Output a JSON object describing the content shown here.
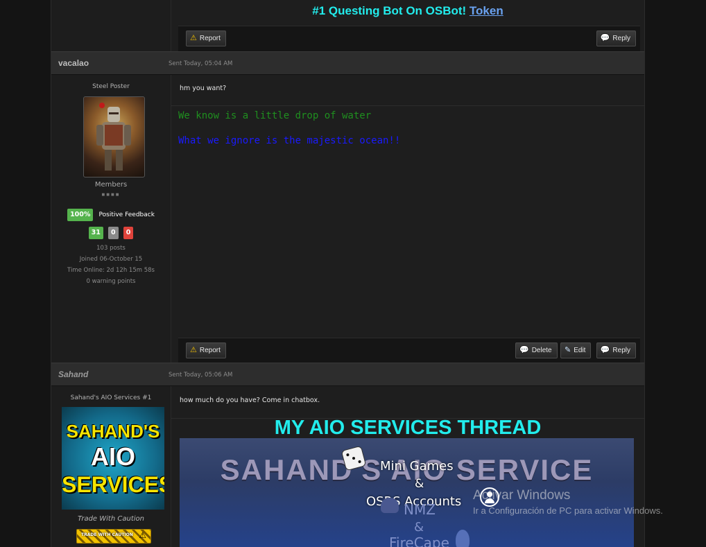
{
  "top_post": {
    "signature": {
      "prefix": "#1 Questing Bot On OSBot! ",
      "link": "Token"
    },
    "buttons": {
      "report": "Report",
      "reply": "Reply"
    }
  },
  "post1": {
    "username": "vacalao",
    "sent": "Sent Today, 05:04 AM",
    "user_title": "Steel Poster",
    "group": "Members",
    "pips": "■■■■",
    "feedback": {
      "percent": "100%",
      "label": "Positive Feedback",
      "positive": "31",
      "neutral": "0",
      "negative": "0"
    },
    "stats": {
      "posts": "103 posts",
      "joined": "Joined 06-October 15",
      "online": "Time Online: 2d 12h 15m 58s",
      "warnings": "0 warning points"
    },
    "message": "hm you want?",
    "signature": {
      "line1": "We know is a little drop of water",
      "line2": "What we ignore is the majestic ocean!!"
    },
    "buttons": {
      "report": "Report",
      "delete": "Delete",
      "edit": "Edit",
      "reply": "Reply"
    }
  },
  "post2": {
    "username": "Sahand",
    "sent": "Sent Today, 05:06 AM",
    "user_title": "Sahand's AIO Services #1",
    "avatar_text": {
      "line1": "SAHAND'S",
      "line2": "AIO",
      "line3": "SERVICES"
    },
    "caution": "Trade With Caution",
    "badge_text": "TRADE WITH CAUTION",
    "message": "how much do you have? Come in chatbox.",
    "signature": {
      "title": "MY AIO SERVICES THREAD",
      "banner_title": "SAHAND'S AIO SERVICE",
      "lines": [
        "Mini Games",
        "&",
        "OSRS Accounts",
        "NMZ",
        "&",
        "FireCape"
      ]
    }
  },
  "windows_watermark": {
    "title": "Activar Windows",
    "subtitle": "Ir a Configuración de PC para activar Windows."
  },
  "colors": {
    "accent_cyan": "#22ecec",
    "link_blue": "#6aa2f0",
    "green": "#55b34d",
    "sig_green": "#1f8f1f",
    "sig_blue": "#1a1aff",
    "neutral_gray": "#8a8a8a",
    "negative_red": "#e0433b"
  }
}
